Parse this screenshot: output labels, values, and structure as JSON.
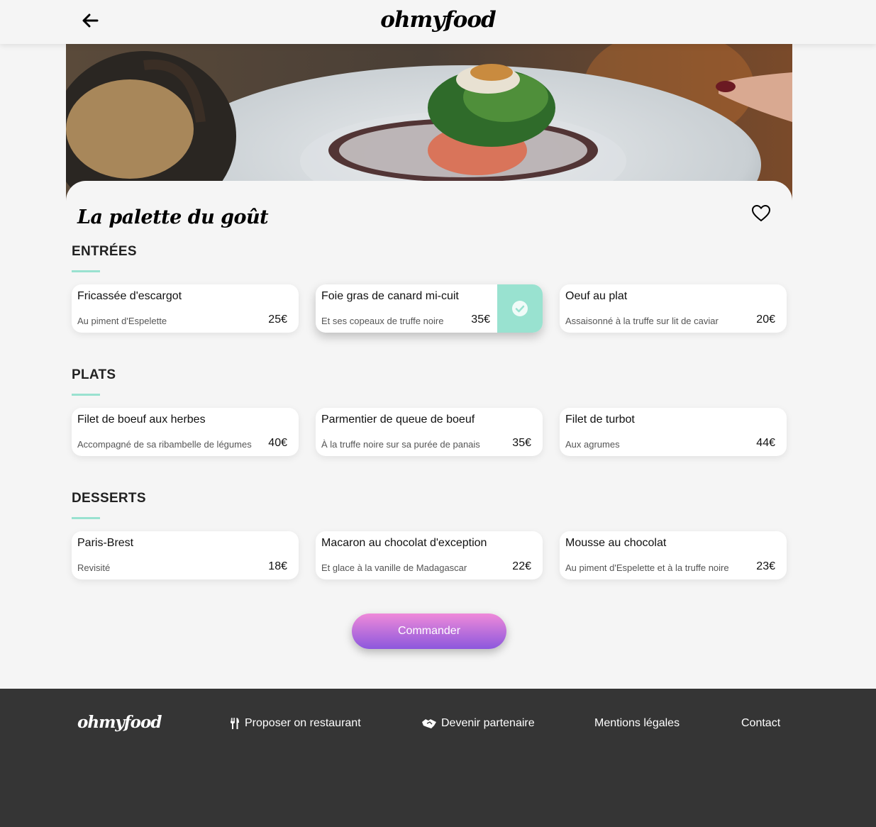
{
  "header": {
    "logo": "ohmyfood",
    "back_icon": "arrow-left-icon"
  },
  "restaurant": {
    "name": "La palette du goût",
    "favorite_icon": "heart-outline-icon"
  },
  "sections": [
    {
      "title": "ENTRÉES",
      "items": [
        {
          "name": "Fricassée d'escargot",
          "description": "Au piment d'Espelette",
          "price": "25€",
          "selected": false
        },
        {
          "name": "Foie gras de canard mi-cuit",
          "description": "Et ses copeaux de truffe noire",
          "price": "35€",
          "selected": true
        },
        {
          "name": "Oeuf au plat",
          "description": "Assaisonné à la truffe sur lit de caviar",
          "price": "20€",
          "selected": false
        }
      ]
    },
    {
      "title": "PLATS",
      "items": [
        {
          "name": "Filet de boeuf aux herbes",
          "description": "Accompagné de sa ribambelle de légumes",
          "price": "40€",
          "selected": false
        },
        {
          "name": "Parmentier de queue de boeuf",
          "description": "À la truffe noire sur sa purée de panais",
          "price": "35€",
          "selected": false
        },
        {
          "name": "Filet de turbot",
          "description": "Aux agrumes",
          "price": "44€",
          "selected": false
        }
      ]
    },
    {
      "title": "DESSERTS",
      "items": [
        {
          "name": "Paris-Brest",
          "description": "Revisité",
          "price": "18€",
          "selected": false
        },
        {
          "name": "Macaron au chocolat d'exception",
          "description": "Et glace à la vanille de Madagascar",
          "price": "22€",
          "selected": false
        },
        {
          "name": "Mousse au chocolat",
          "description": "Au piment d'Espelette et à la truffe noire",
          "price": "23€",
          "selected": false
        }
      ]
    }
  ],
  "order_button": "Commander",
  "footer": {
    "logo": "ohmyfood",
    "links": [
      {
        "label": "Proposer on restaurant",
        "icon": "utensils-icon"
      },
      {
        "label": "Devenir partenaire",
        "icon": "handshake-icon"
      },
      {
        "label": "Mentions légales",
        "icon": ""
      },
      {
        "label": "Contact",
        "icon": ""
      }
    ]
  },
  "colors": {
    "accent": "#99e2d0",
    "button_gradient_top": "#ef89d9",
    "button_gradient_bottom": "#8c58dd",
    "footer_bg": "#353535"
  }
}
